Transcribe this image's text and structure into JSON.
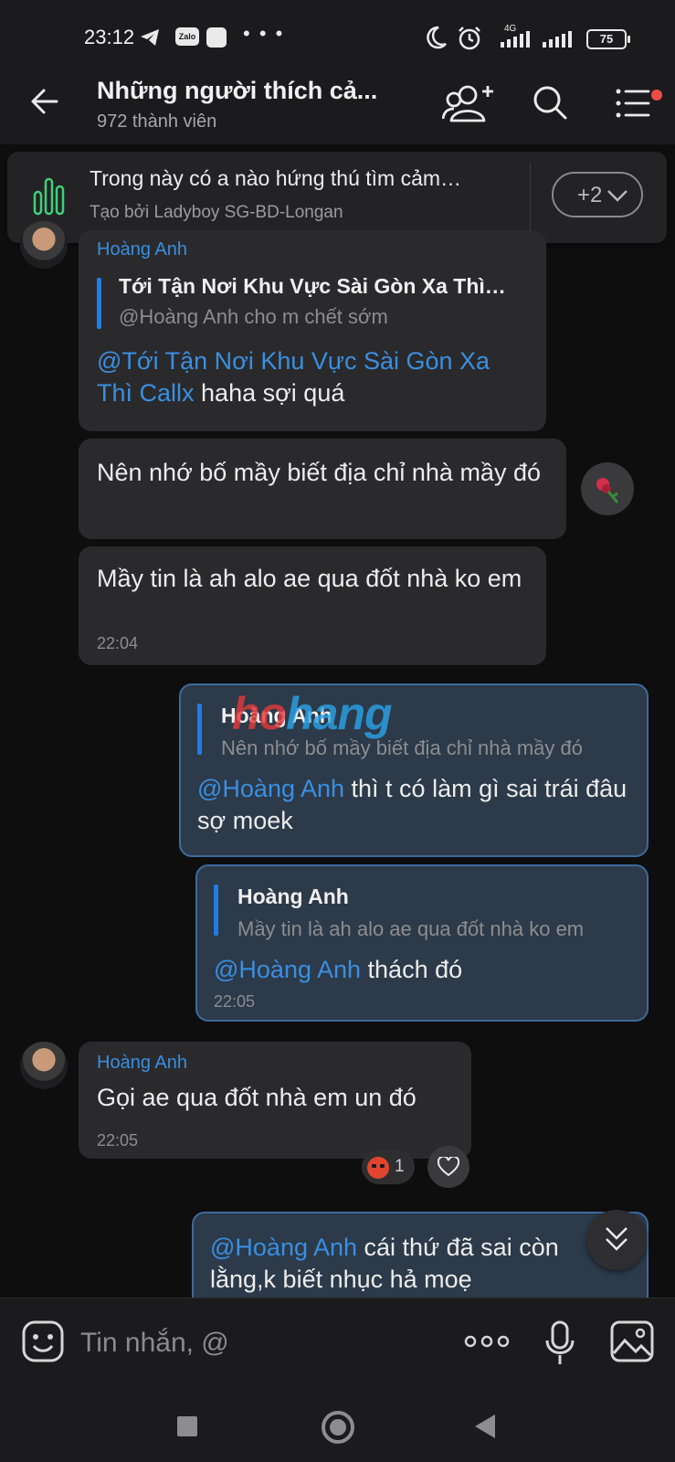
{
  "status_bar": {
    "time": "23:12",
    "zalo_label": "Zalo",
    "more": "• • •",
    "network": "4G",
    "battery": "75"
  },
  "header": {
    "title": "Những người thích cả...",
    "member_count": "972 thành viên"
  },
  "poll": {
    "question": "Trong này có a nào hứng thú tìm cảm…",
    "created_by": "Tạo bởi Ladyboy SG-BD-Longan",
    "more_count": "+2"
  },
  "messages": [
    {
      "sender": "Hoàng Anh",
      "quote_title": "Tới Tận Nơi Khu Vực Sài Gòn Xa Thì…",
      "quote_text": "@Hoàng Anh  cho m chết sớm",
      "mention": "@Tới Tận Nơi Khu Vực Sài Gòn Xa Thì Callx",
      "text": " haha sợi quá"
    },
    {
      "text": "Nên nhớ bố mầy biết địa chỉ nhà mầy đó"
    },
    {
      "text": "Mầy tin là ah alo ae qua đốt nhà ko em",
      "time": "22:04"
    },
    {
      "quote_title": "Hoàng Anh",
      "quote_text": "Nên nhớ bố mầy biết địa chỉ nhà mầy đó",
      "mention": "@Hoàng Anh",
      "text": " thì t có làm gì sai trái đâu sợ moek"
    },
    {
      "quote_title": "Hoàng Anh",
      "quote_text": "Mầy tin là ah alo ae qua đốt nhà ko em",
      "mention": "@Hoàng Anh",
      "text": " thách đó",
      "time": "22:05"
    },
    {
      "sender": "Hoàng Anh",
      "text": "Gọi ae qua đốt nhà em un đó",
      "time": "22:05",
      "reaction_count": "1"
    },
    {
      "mention": "@Hoàng Anh",
      "text": " cái thứ đã sai còn lằng,k biết nhục hả moẹ"
    }
  ],
  "watermark": {
    "part_a": "ho",
    "part_b": "hang"
  },
  "composer": {
    "placeholder": "Tin nhắn, @",
    "more": "ooo"
  },
  "icons": [
    "back-arrow-icon",
    "add-member-icon",
    "search-icon",
    "menu-icon",
    "poll-icon",
    "chevron-down-icon",
    "heart-icon",
    "emoji-icon",
    "mic-icon",
    "image-icon"
  ]
}
